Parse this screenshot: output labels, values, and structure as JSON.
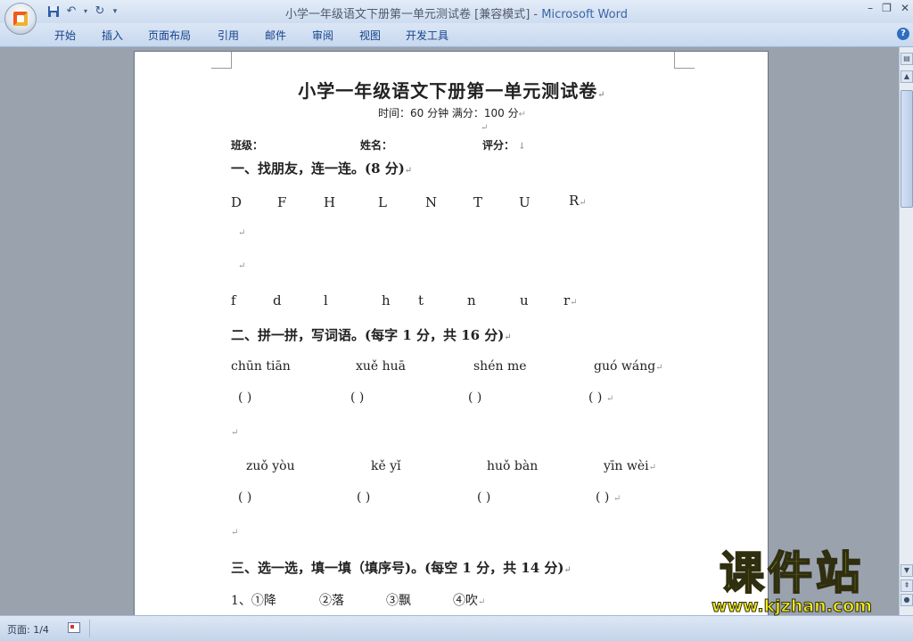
{
  "titlebar": {
    "document_title": "小学一年级语文下册第一单元测试卷 [兼容模式]",
    "separator": " - ",
    "app_name": "Microsoft Word",
    "qat": {
      "save_icon": "save-icon",
      "undo_icon": "undo-icon",
      "redo_icon": "redo-icon",
      "customize_icon": "customize-icon"
    },
    "controls": {
      "minimize": "–",
      "restore": "❐",
      "close": "✕"
    }
  },
  "ribbon": {
    "tabs": [
      "开始",
      "插入",
      "页面布局",
      "引用",
      "邮件",
      "审阅",
      "视图",
      "开发工具"
    ],
    "help": "?"
  },
  "document": {
    "title": "小学一年级语文下册第一单元测试卷",
    "meta": "时间：60 分钟    满分：100 分",
    "fields": {
      "class": "班级：",
      "name": "姓名：",
      "score": "评分："
    },
    "section1": {
      "heading": "一、找朋友，连一连。(8 分)",
      "upper": [
        "D",
        "F",
        "H",
        "L",
        "N",
        "T",
        "U",
        "R"
      ],
      "lower": [
        "f",
        "d",
        "l",
        "h",
        "t",
        "n",
        "u",
        "r"
      ]
    },
    "section2": {
      "heading": "二、拼一拼，写词语。(每字 1 分，共 16 分)",
      "row1": [
        "chūn  tiān",
        "xuě  huā",
        "shén  me",
        "guó  wáng"
      ],
      "row2": [
        "zuǒ  yòu",
        "kě  yǐ",
        "huǒ  bàn",
        "yīn  wèi"
      ],
      "blank": "(          )"
    },
    "section3": {
      "heading": "三、选一选，填一填（填序号)。(每空 1 分，共 14 分)",
      "q1": [
        "1、①降",
        "②落",
        "③飘",
        "④吹"
      ]
    },
    "para_mark": "↵",
    "down_mark": "↓"
  },
  "status": {
    "page": "页面: 1/4"
  },
  "watermark": {
    "main": "课件站",
    "url": "www.kjzhan.com"
  }
}
